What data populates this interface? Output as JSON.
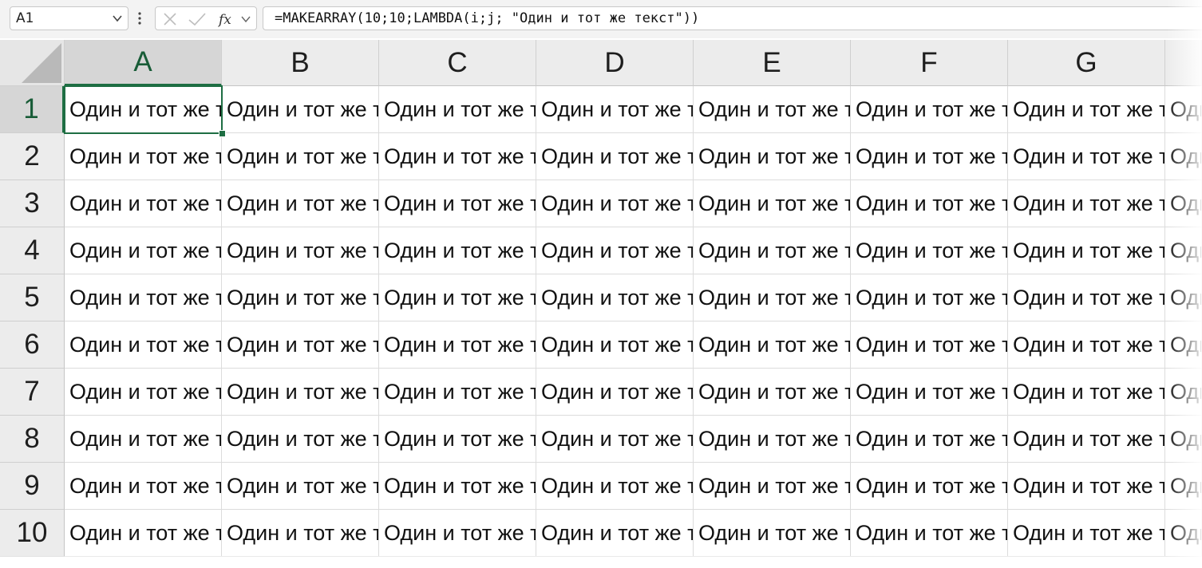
{
  "formula_bar": {
    "name_box": "A1",
    "formula": "=MAKEARRAY(10;10;LAMBDA(i;j; \"Один и тот же текст\"))",
    "icons": [
      "chevron-down-icon",
      "more-options-icon",
      "cancel-icon",
      "enter-icon",
      "function-icon",
      "chevron-down-icon"
    ]
  },
  "grid": {
    "columns": [
      "A",
      "B",
      "C",
      "D",
      "E",
      "F",
      "G"
    ],
    "rows": [
      "1",
      "2",
      "3",
      "4",
      "5",
      "6",
      "7",
      "8",
      "9",
      "10"
    ],
    "selected_column": "A",
    "selected_row": "1",
    "cell_text": "Один и тот же текст"
  },
  "colors": {
    "accent_green": "#1e6e43",
    "header_bg": "#ececec",
    "selected_header_bg": "#d6d6d6"
  }
}
